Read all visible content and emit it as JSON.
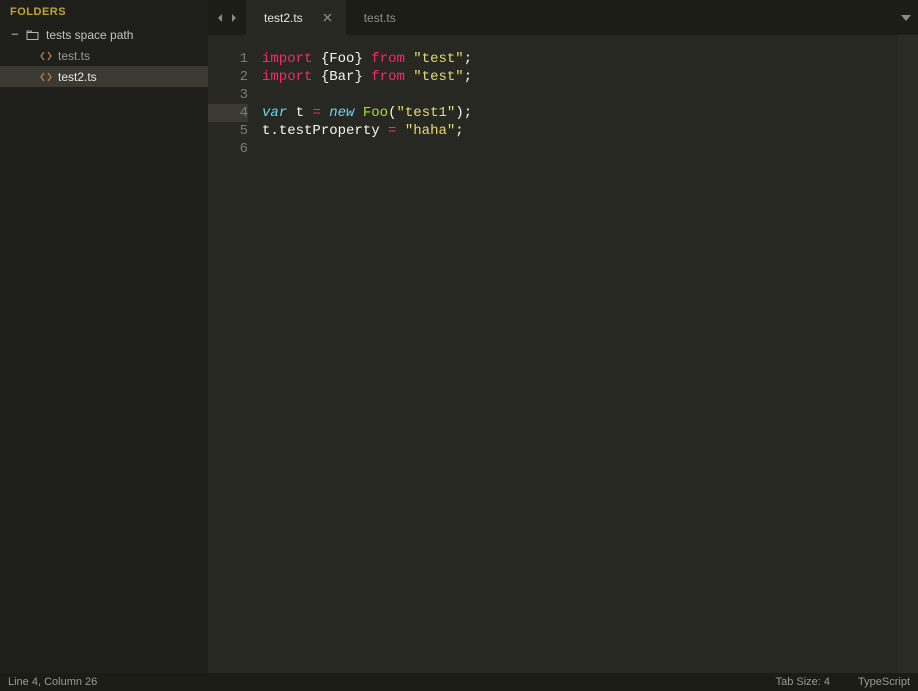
{
  "sidebar": {
    "header": "FOLDERS",
    "folder": {
      "name": "tests space path"
    },
    "files": [
      {
        "name": "test.ts",
        "active": false
      },
      {
        "name": "test2.ts",
        "active": true
      }
    ]
  },
  "tabs": [
    {
      "name": "test2.ts",
      "active": true
    },
    {
      "name": "test.ts",
      "active": false
    }
  ],
  "code": {
    "lines": {
      "1": {
        "no": "1",
        "segments": [
          [
            "import",
            "keyword"
          ],
          [
            " ",
            "ident"
          ],
          [
            "{",
            "punc"
          ],
          [
            "Foo",
            "ident"
          ],
          [
            "}",
            "punc"
          ],
          [
            " ",
            "ident"
          ],
          [
            "from",
            "keyword"
          ],
          [
            " ",
            "ident"
          ],
          [
            "\"test\"",
            "string"
          ],
          [
            ";",
            "punc"
          ]
        ]
      },
      "2": {
        "no": "2",
        "segments": [
          [
            "import",
            "keyword"
          ],
          [
            " ",
            "ident"
          ],
          [
            "{",
            "punc"
          ],
          [
            "Bar",
            "ident"
          ],
          [
            "}",
            "punc"
          ],
          [
            " ",
            "ident"
          ],
          [
            "from",
            "keyword"
          ],
          [
            " ",
            "ident"
          ],
          [
            "\"test\"",
            "string"
          ],
          [
            ";",
            "punc"
          ]
        ]
      },
      "3": {
        "no": "3",
        "segments": []
      },
      "4": {
        "no": "4",
        "highlight": true,
        "segments": [
          [
            "var",
            "var"
          ],
          [
            " ",
            "ident"
          ],
          [
            "t",
            "ident"
          ],
          [
            " ",
            "ident"
          ],
          [
            "=",
            "op"
          ],
          [
            " ",
            "ident"
          ],
          [
            "new",
            "keyword2"
          ],
          [
            " ",
            "ident"
          ],
          [
            "Foo",
            "name"
          ],
          [
            "(",
            "punc"
          ],
          [
            "\"test1\"",
            "string"
          ],
          [
            ")",
            "punc"
          ],
          [
            ";",
            "punc"
          ]
        ]
      },
      "5": {
        "no": "5",
        "segments": [
          [
            "t",
            "ident"
          ],
          [
            ".",
            "punc"
          ],
          [
            "testProperty",
            "ident"
          ],
          [
            " ",
            "ident"
          ],
          [
            "=",
            "op"
          ],
          [
            " ",
            "ident"
          ],
          [
            "\"haha\"",
            "string"
          ],
          [
            ";",
            "punc"
          ]
        ]
      },
      "6": {
        "no": "6",
        "segments": []
      }
    }
  },
  "status": {
    "cursor": "Line 4, Column 26",
    "tab_size": "Tab Size: 4",
    "language": "TypeScript"
  }
}
